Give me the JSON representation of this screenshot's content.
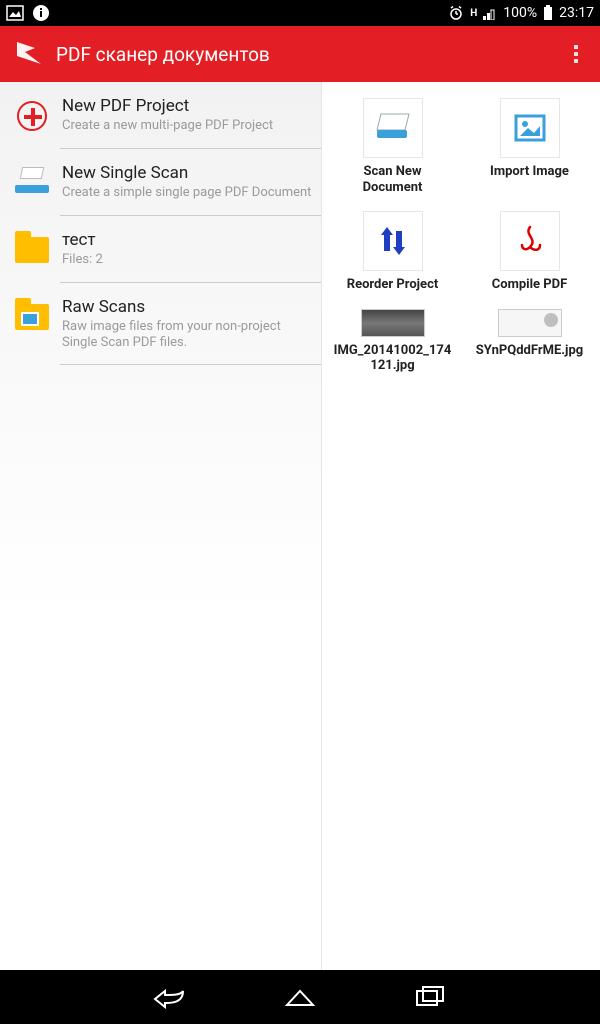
{
  "statusbar": {
    "battery": "100%",
    "clock": "23:17",
    "net_label": "H"
  },
  "appbar": {
    "title": "PDF сканер документов"
  },
  "left_items": [
    {
      "title": "New PDF Project",
      "sub": "Create a new multi-page PDF Project"
    },
    {
      "title": "New Single Scan",
      "sub": "Create a simple single page PDF Document"
    },
    {
      "title": "тест",
      "sub": "Files: 2"
    },
    {
      "title": "Raw Scans",
      "sub": "Raw image files from your non-project Single Scan PDF files."
    }
  ],
  "actions": [
    {
      "label": "Scan New Document"
    },
    {
      "label": "Import Image"
    },
    {
      "label": "Reorder Project"
    },
    {
      "label": "Compile PDF"
    }
  ],
  "files": [
    {
      "label": "IMG_20141002_174121.jpg"
    },
    {
      "label": "SYnPQddFrME.jpg"
    }
  ]
}
